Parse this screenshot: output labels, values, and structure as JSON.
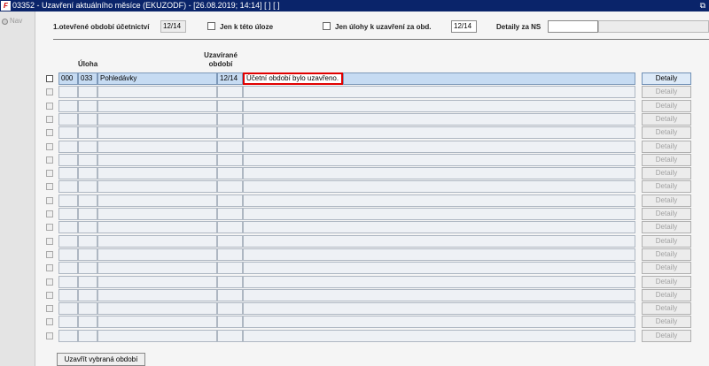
{
  "window": {
    "title": "03352 - Uzavření aktuálního měsíce (EKUZODF) - [26.08.2019; 14:14]  [ ]  [ ]",
    "app_icon": "app-logo-icon",
    "restore_icon": "restore-window-icon"
  },
  "sidebar": {
    "nav_label": "Nav"
  },
  "filters": {
    "open_period_label": "1.otevřené období účetnictví",
    "open_period_value": "12/14",
    "only_task_label": "Jen k této úloze",
    "only_closing_label": "Jen úlohy k uzavření za obd.",
    "closing_period_value": "12/14",
    "details_ns_label": "Detaily za NS",
    "details_ns_value": "",
    "details_ns_extra": ""
  },
  "table": {
    "headers": {
      "task": "Úloha",
      "closing_period_line1": "Uzavírané",
      "closing_period_line2": "období"
    },
    "rows": [
      {
        "code1": "000",
        "code2": "033",
        "name": "Pohledávky",
        "period": "12/14",
        "message": "Účetní období bylo uzavřeno.",
        "details": "Detaily"
      },
      {
        "code1": "",
        "code2": "",
        "name": "",
        "period": "",
        "message": "",
        "details": "Detaily"
      },
      {
        "code1": "",
        "code2": "",
        "name": "",
        "period": "",
        "message": "",
        "details": "Detaily"
      },
      {
        "code1": "",
        "code2": "",
        "name": "",
        "period": "",
        "message": "",
        "details": "Detaily"
      },
      {
        "code1": "",
        "code2": "",
        "name": "",
        "period": "",
        "message": "",
        "details": "Detaily"
      },
      {
        "code1": "",
        "code2": "",
        "name": "",
        "period": "",
        "message": "",
        "details": "Detaily"
      },
      {
        "code1": "",
        "code2": "",
        "name": "",
        "period": "",
        "message": "",
        "details": "Detaily"
      },
      {
        "code1": "",
        "code2": "",
        "name": "",
        "period": "",
        "message": "",
        "details": "Detaily"
      },
      {
        "code1": "",
        "code2": "",
        "name": "",
        "period": "",
        "message": "",
        "details": "Detaily"
      },
      {
        "code1": "",
        "code2": "",
        "name": "",
        "period": "",
        "message": "",
        "details": "Detaily"
      },
      {
        "code1": "",
        "code2": "",
        "name": "",
        "period": "",
        "message": "",
        "details": "Detaily"
      },
      {
        "code1": "",
        "code2": "",
        "name": "",
        "period": "",
        "message": "",
        "details": "Detaily"
      },
      {
        "code1": "",
        "code2": "",
        "name": "",
        "period": "",
        "message": "",
        "details": "Detaily"
      },
      {
        "code1": "",
        "code2": "",
        "name": "",
        "period": "",
        "message": "",
        "details": "Detaily"
      },
      {
        "code1": "",
        "code2": "",
        "name": "",
        "period": "",
        "message": "",
        "details": "Detaily"
      },
      {
        "code1": "",
        "code2": "",
        "name": "",
        "period": "",
        "message": "",
        "details": "Detaily"
      },
      {
        "code1": "",
        "code2": "",
        "name": "",
        "period": "",
        "message": "",
        "details": "Detaily"
      },
      {
        "code1": "",
        "code2": "",
        "name": "",
        "period": "",
        "message": "",
        "details": "Detaily"
      },
      {
        "code1": "",
        "code2": "",
        "name": "",
        "period": "",
        "message": "",
        "details": "Detaily"
      },
      {
        "code1": "",
        "code2": "",
        "name": "",
        "period": "",
        "message": "",
        "details": "Detaily"
      }
    ]
  },
  "actions": {
    "close_selected_label": "Uzavřít vybraná období"
  },
  "colors": {
    "titlebar": "#0a246a",
    "active_row": "#c6dbf2",
    "highlight_border": "#e00000"
  }
}
